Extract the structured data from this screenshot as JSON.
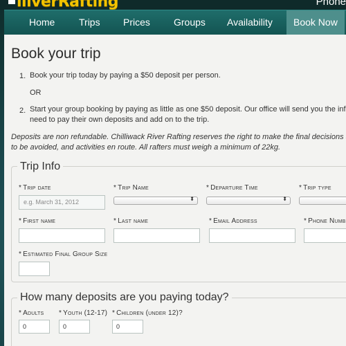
{
  "header": {
    "logo_text": "iiiverRafting",
    "phone_text": "Phone"
  },
  "nav": {
    "items": [
      {
        "label": "Home"
      },
      {
        "label": "Trips"
      },
      {
        "label": "Prices"
      },
      {
        "label": "Groups"
      },
      {
        "label": "Availability"
      },
      {
        "label": "Book Now",
        "active": true
      }
    ]
  },
  "page": {
    "title": "Book your trip",
    "steps": [
      {
        "num": "1.",
        "text": "Book your trip today by paying a $50 deposit per person."
      },
      {
        "num": "2.",
        "text_line1": "Start your group booking by paying as little as one $50 deposit. Our office will send you the information yo",
        "text_line2": "need to pay their own deposits and add on to the trip."
      }
    ],
    "or_text": "OR",
    "disclaimer_line1": "Deposits are non refundable. Chilliwack River Rafting reserves the right to make the final decisions around runs t",
    "disclaimer_line2": "to be avoided, and activities en route. All rafters must weigh a minimum of 22kg."
  },
  "trip_info": {
    "legend": "Trip Info",
    "required_marker": "*",
    "trip_date_label": "Trip date",
    "trip_date_placeholder": "e.g. March 31, 2012",
    "trip_name_label": "Trip Name",
    "departure_time_label": "Departure Time",
    "trip_type_label": "Trip type",
    "first_name_label": "First name",
    "last_name_label": "Last name",
    "email_label": "Email Address",
    "phone_label": "Phone Numb",
    "group_size_label": "Estimated Final Group Size"
  },
  "deposits": {
    "legend": "How many deposits are you paying today?",
    "adults_label": "Adults",
    "youth_label": "Youth (12-17)",
    "children_label": "Children (under 12)?",
    "adults_value": "0",
    "youth_value": "0",
    "children_value": "0"
  },
  "select_arrows": "▲▼"
}
